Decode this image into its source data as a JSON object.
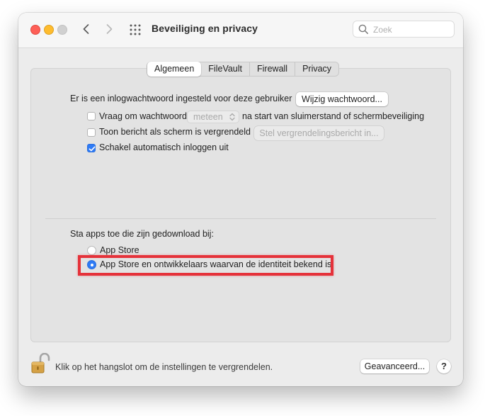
{
  "window": {
    "title": "Beveiliging en privacy",
    "search_placeholder": "Zoek"
  },
  "tabs": [
    {
      "label": "Algemeen",
      "selected": true
    },
    {
      "label": "FileVault",
      "selected": false
    },
    {
      "label": "Firewall",
      "selected": false
    },
    {
      "label": "Privacy",
      "selected": false
    }
  ],
  "general": {
    "password_text": "Er is een inlogwachtwoord ingesteld voor deze gebruiker",
    "change_password_button": "Wijzig wachtwoord...",
    "require_password": {
      "label": "Vraag om wachtwoord",
      "checked": false,
      "select_value": "meteen",
      "suffix": "na start van sluimerstand of schermbeveiliging"
    },
    "show_message": {
      "label": "Toon bericht als scherm is vergrendeld",
      "checked": false,
      "button": "Stel vergrendelingsbericht in..."
    },
    "disable_autologin": {
      "label": "Schakel automatisch inloggen uit",
      "checked": true
    }
  },
  "apps": {
    "heading": "Sta apps toe die zijn gedownload bij:",
    "options": [
      {
        "label": "App Store",
        "selected": false
      },
      {
        "label": "App Store en ontwikkelaars waarvan de identiteit bekend is",
        "selected": true
      }
    ]
  },
  "footer": {
    "lock_text": "Klik op het hangslot om de instellingen te vergrendelen.",
    "advanced_button": "Geavanceerd...",
    "help_button": "?"
  },
  "colors": {
    "accent": "#2f7bf5",
    "highlight": "#e5323a",
    "traffic_red": "#fe5f57",
    "traffic_yellow": "#febc2e"
  },
  "icons": [
    "back-chevron-icon",
    "forward-chevron-icon",
    "grid-icon",
    "search-icon",
    "checkmark-icon",
    "updown-arrows-icon",
    "lock-open-icon"
  ]
}
